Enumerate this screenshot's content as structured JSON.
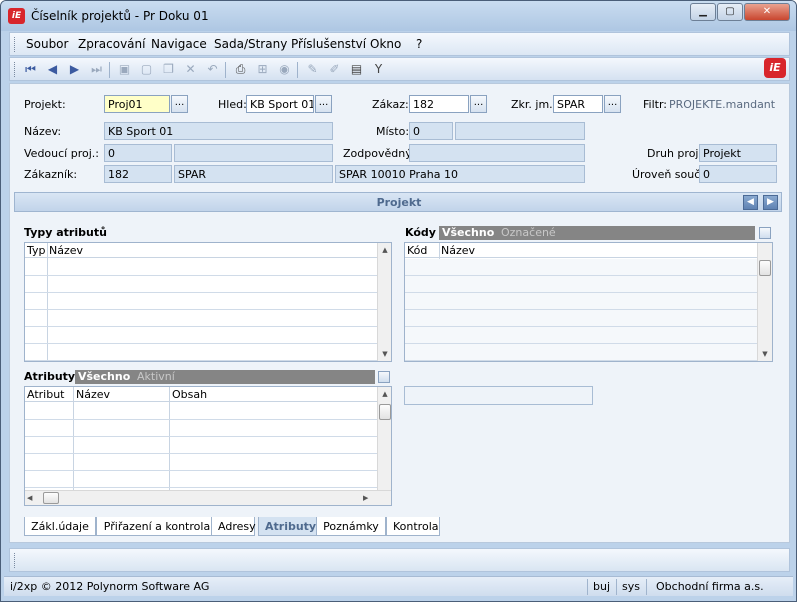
{
  "window": {
    "title": "Číselník projektů - Pr Doku 01",
    "app_icon": "iE"
  },
  "menu": [
    "Soubor",
    "Zpracování",
    "Navigace",
    "Sada/Strany",
    "Příslušenství",
    "Okno",
    "?"
  ],
  "toolbar_icons": [
    "first-icon",
    "prev-icon",
    "next-icon",
    "last-icon",
    "save-icon",
    "new-icon",
    "copy-icon",
    "delete-icon",
    "undo-icon",
    "print-icon",
    "tree-icon",
    "refresh-icon",
    "edit-icon",
    "highlight-icon",
    "report-icon",
    "filter-icon"
  ],
  "form": {
    "projekt_label": "Projekt:",
    "projekt_value": "Proj01",
    "hled_label": "Hled:",
    "hled_value": "KB Sport 01",
    "zakaz_label": "Zákaz:",
    "zakaz_value": "182",
    "zkr_label": "Zkr. jm.:",
    "zkr_value": "SPAR",
    "filtr_label": "Filtr:",
    "filtr_value": "PROJEKTE.mandant",
    "nazev_label": "Název:",
    "nazev_value": "KB Sport 01",
    "misto_label": "Místo:",
    "misto_value": "0",
    "misto_value2": "",
    "vedouci_label": "Vedoucí proj.:",
    "vedouci_value": "0",
    "vedouci_value2": "",
    "zodp_label": "Zodpovědný:",
    "zodp_value": "",
    "druh_label": "Druh proj.:",
    "druh_value": "Projekt",
    "zakaznik_label": "Zákazník:",
    "zakaznik_value": "182",
    "zakaznik_name": "SPAR",
    "zakaznik_addr": "SPAR 10010 Praha 10",
    "uroven_label": "Úroveň souč:",
    "uroven_value": "0",
    "dots": "..."
  },
  "section": {
    "title": "Projekt"
  },
  "typy": {
    "title": "Typy atributů",
    "col_typ": "Typ",
    "col_nazev": "Název"
  },
  "kody": {
    "title": "Kódy",
    "seg_all": "Všechno",
    "seg_marked": "Označené",
    "col_kod": "Kód",
    "col_nazev": "Název"
  },
  "atributy": {
    "title": "Atributy",
    "seg_all": "Všechno",
    "seg_active": "Aktivní",
    "col_atribut": "Atribut",
    "col_nazev": "Název",
    "col_obsah": "Obsah"
  },
  "tabs": [
    "Zákl.údaje",
    "Přiřazení a kontrola",
    "Adresy",
    "Atributy",
    "Poznámky",
    "Kontrola"
  ],
  "active_tab": "Atributy",
  "status": {
    "copyright": "i/2xp © 2012 Polynorm Software AG",
    "user": "buj",
    "db": "sys",
    "company": "Obchodní firma a.s."
  }
}
